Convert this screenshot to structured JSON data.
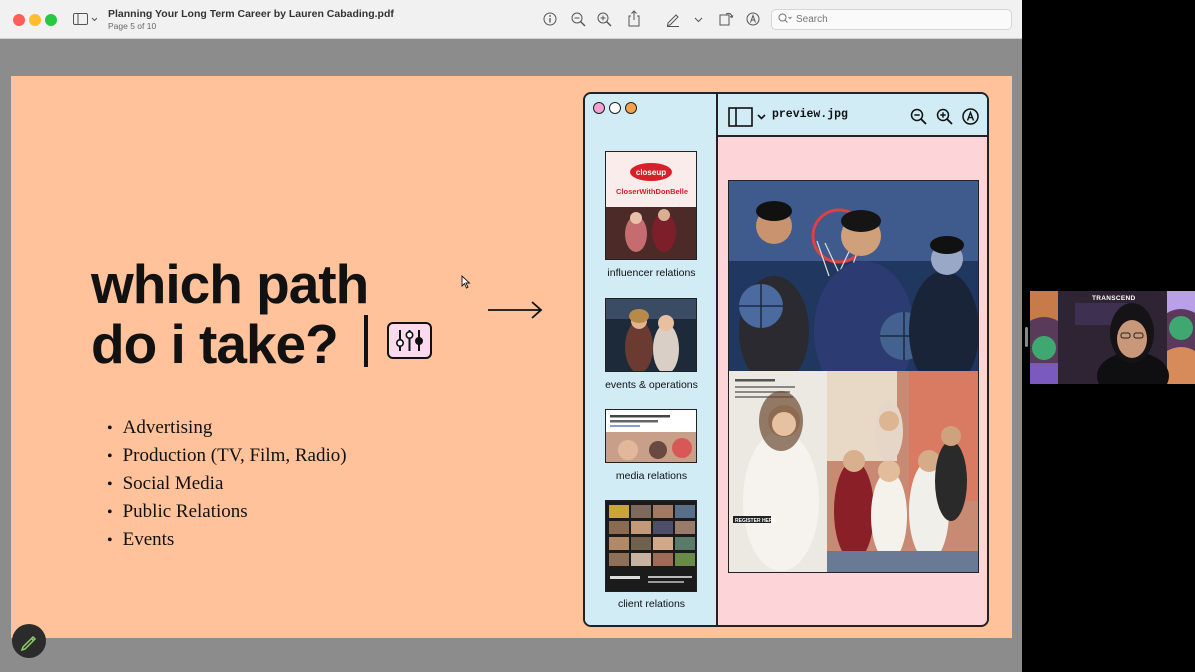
{
  "window": {
    "title": "Planning Your Long Term Career by Lauren Cabading.pdf",
    "page_indicator": "Page 5 of 10"
  },
  "toolbar": {
    "sidebar_toggle_icon": "sidebar-icon",
    "info_icon": "info-icon",
    "zoom_out_icon": "zoom-out-icon",
    "zoom_in_icon": "zoom-in-icon",
    "share_icon": "share-icon",
    "markup_icon": "pencil-icon",
    "rotate_icon": "rotate-icon",
    "annotate_icon": "annotate-icon",
    "search_placeholder": "Search"
  },
  "slide": {
    "headline_line1": "which path",
    "headline_line2": "do i take?",
    "bullets": [
      "Advertising",
      "Production (TV, Film, Radio)",
      "Social Media",
      "Public Relations",
      "Events"
    ],
    "mock_window": {
      "file_name": "preview.jpg",
      "thumbnails": [
        {
          "label": "influencer relations",
          "banner": "CloserWithDonBelle",
          "brand": "closeup"
        },
        {
          "label": "events & operations"
        },
        {
          "label": "media relations"
        },
        {
          "label": "client relations"
        }
      ],
      "overlay_text": "REGISTER HERE"
    }
  },
  "video_tile": {
    "caption": "TRANSCEND"
  },
  "colors": {
    "slide_bg": "#ffc29b",
    "mock_sidebar": "#d1ecf5",
    "mock_canvas": "#fdd4d8",
    "dot_pink": "#f5a0d0",
    "dot_white": "#ffffff",
    "dot_orange": "#f7a04b"
  }
}
